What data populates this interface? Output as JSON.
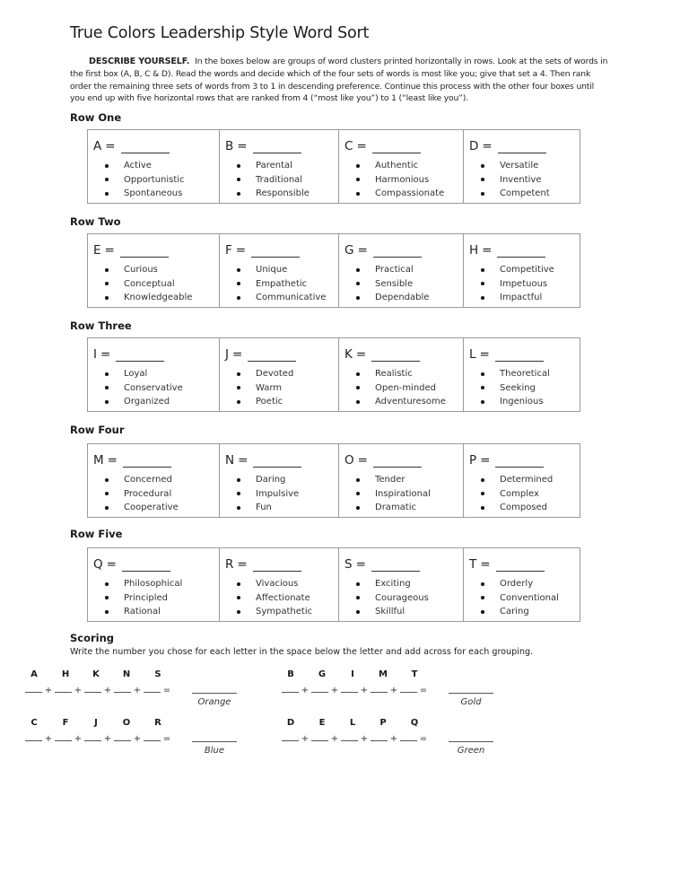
{
  "title": "True Colors Leadership Style Word Sort",
  "intro": {
    "lead": "DESCRIBE YOURSELF.",
    "text": "In the boxes below are groups of word clusters printed horizontally in rows.  Look at the sets of words in the first box (A, B, C & D).  Read the words and decide which of the four sets of words is most like you; give that set a 4.  Then rank order the remaining three sets of words from 3 to 1 in descending preference.  Continue this process with the other four boxes until you end up with five horizontal rows that are ranked from 4 (“most like you”) to 1 (“least like you”)."
  },
  "rows": [
    {
      "heading": "Row One",
      "sets": [
        {
          "letter": "A",
          "words": [
            "Active",
            "Opportunistic",
            "Spontaneous"
          ],
          "rank": ""
        },
        {
          "letter": "B",
          "words": [
            "Parental",
            "Traditional",
            "Responsible"
          ],
          "rank": ""
        },
        {
          "letter": "C",
          "words": [
            "Authentic",
            "Harmonious",
            "Compassionate"
          ],
          "rank": ""
        },
        {
          "letter": "D",
          "words": [
            "Versatile",
            "Inventive",
            "Competent"
          ],
          "rank": ""
        }
      ]
    },
    {
      "heading": "Row Two",
      "sets": [
        {
          "letter": "E",
          "words": [
            "Curious",
            "Conceptual",
            "Knowledgeable"
          ],
          "rank": ""
        },
        {
          "letter": "F",
          "words": [
            "Unique",
            "Empathetic",
            "Communicative"
          ],
          "rank": ""
        },
        {
          "letter": "G",
          "words": [
            "Practical",
            "Sensible",
            "Dependable"
          ],
          "rank": ""
        },
        {
          "letter": "H",
          "words": [
            "Competitive",
            "Impetuous",
            "Impactful"
          ],
          "rank": ""
        }
      ]
    },
    {
      "heading": "Row Three",
      "sets": [
        {
          "letter": "I",
          "words": [
            "Loyal",
            "Conservative",
            "Organized"
          ],
          "rank": ""
        },
        {
          "letter": "J",
          "words": [
            "Devoted",
            "Warm",
            "Poetic"
          ],
          "rank": ""
        },
        {
          "letter": "K",
          "words": [
            "Realistic",
            "Open-minded",
            "Adventuresome"
          ],
          "rank": ""
        },
        {
          "letter": "L",
          "words": [
            "Theoretical",
            "Seeking",
            "Ingenious"
          ],
          "rank": ""
        }
      ]
    },
    {
      "heading": "Row Four",
      "sets": [
        {
          "letter": "M",
          "words": [
            "Concerned",
            "Procedural",
            "Cooperative"
          ],
          "rank": ""
        },
        {
          "letter": "N",
          "words": [
            "Daring",
            "Impulsive",
            "Fun"
          ],
          "rank": ""
        },
        {
          "letter": "O",
          "words": [
            "Tender",
            "Inspirational",
            "Dramatic"
          ],
          "rank": ""
        },
        {
          "letter": "P",
          "words": [
            "Determined",
            "Complex",
            "Composed"
          ],
          "rank": ""
        }
      ]
    },
    {
      "heading": "Row Five",
      "sets": [
        {
          "letter": "Q",
          "words": [
            "Philosophical",
            "Principled",
            "Rational"
          ],
          "rank": ""
        },
        {
          "letter": "R",
          "words": [
            "Vivacious",
            "Affectionate",
            "Sympathetic"
          ],
          "rank": ""
        },
        {
          "letter": "S",
          "words": [
            "Exciting",
            "Courageous",
            "Skillful"
          ],
          "rank": ""
        },
        {
          "letter": "T",
          "words": [
            "Orderly",
            "Conventional",
            "Caring"
          ],
          "rank": ""
        }
      ]
    }
  ],
  "scoring": {
    "heading": "Scoring",
    "instructions": "Write the number you chose for each letter in the space below the letter and add across for each grouping.",
    "plus": "+",
    "equals": "=",
    "groups": [
      {
        "letters": [
          "A",
          "H",
          "K",
          "N",
          "S"
        ],
        "color": "Orange"
      },
      {
        "letters": [
          "B",
          "G",
          "I",
          "M",
          "T"
        ],
        "color": "Gold"
      },
      {
        "letters": [
          "C",
          "F",
          "J",
          "O",
          "R"
        ],
        "color": "Blue"
      },
      {
        "letters": [
          "D",
          "E",
          "L",
          "P",
          "Q"
        ],
        "color": "Green"
      }
    ]
  }
}
